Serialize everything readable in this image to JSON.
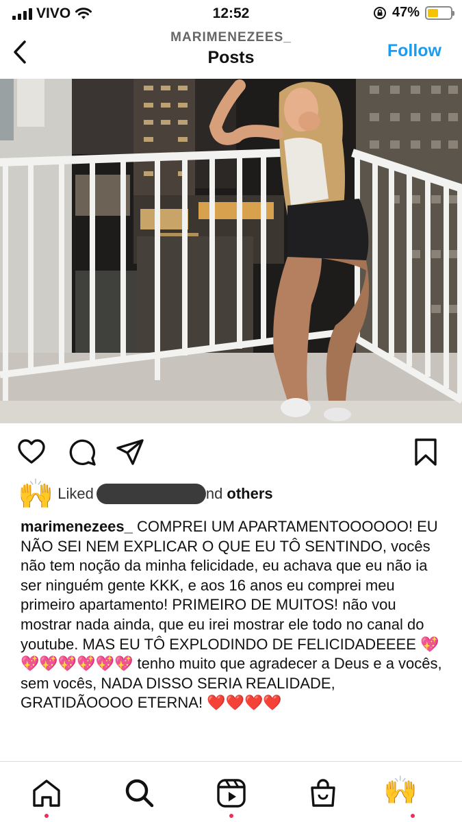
{
  "status_bar": {
    "carrier": "VIVO",
    "time": "12:52",
    "battery_percent": "47%",
    "battery_level": 0.47,
    "icons": [
      "signal-bars-icon",
      "wifi-icon",
      "rotation-lock-icon",
      "battery-icon"
    ]
  },
  "header": {
    "username": "MARIMENEZEES_",
    "title": "Posts",
    "follow_label": "Follow",
    "back_icon": "chevron-left-icon",
    "accent_color": "#1a9cf2"
  },
  "post": {
    "actions": [
      "heart-icon",
      "comment-icon",
      "share-icon",
      "bookmark-icon"
    ],
    "likes": {
      "avatar_emoji": "🙌",
      "liked_prefix": "Liked",
      "liked_suffix": "nd",
      "others": "others"
    },
    "caption": {
      "username": "marimenezees_",
      "text": " COMPREI UM APARTAMENTOOOOOO! EU NÃO SEI NEM EXPLICAR O QUE EU TÔ SENTINDO, vocês não tem noção da minha felicidade, eu achava que eu não ia ser ninguém gente KKK, e aos 16 anos eu comprei meu primeiro apartamento! PRIMEIRO DE MUITOS! não vou mostrar nada ainda, que eu irei mostrar ele todo no canal do youtube. MAS EU TÔ EXPLODINDO DE FELICIDADEEEE 💖💖💖💖💖💖💖 tenho muito que agradecer a Deus e a vocês, sem vocês, NADA DISSO SERIA REALIDADE, GRATIDÃOOOO ETERNA! ❤️❤️❤️❤️"
    }
  },
  "bottom_nav": {
    "items": [
      "home-icon",
      "search-icon",
      "reels-icon",
      "shop-icon",
      "profile-avatar"
    ],
    "avatar_emoji": "🙌",
    "notification_color": "#ef2d56"
  }
}
